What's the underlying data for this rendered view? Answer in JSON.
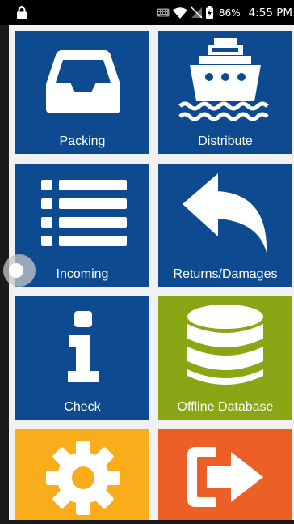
{
  "status_bar": {
    "battery_percent": "86%",
    "time": "4:55 PM",
    "icons": [
      "lock-icon",
      "keyboard-icon",
      "wifi-icon",
      "no-sim-icon",
      "battery-charging-icon"
    ]
  },
  "tiles": [
    {
      "label": "Packing",
      "icon": "inbox-tray-icon",
      "color": "#0d4a90"
    },
    {
      "label": "Distribute",
      "icon": "ship-icon",
      "color": "#0d4a90"
    },
    {
      "label": "Incoming",
      "icon": "list-icon",
      "color": "#0d4a90"
    },
    {
      "label": "Returns/Damages",
      "icon": "reply-arrow-icon",
      "color": "#0d4a90"
    },
    {
      "label": "Check",
      "icon": "info-icon",
      "color": "#0d4a90"
    },
    {
      "label": "Offline Database",
      "icon": "database-icon",
      "color": "#89a615"
    },
    {
      "label": "",
      "icon": "gear-icon",
      "color": "#f9ad1a"
    },
    {
      "label": "",
      "icon": "sign-out-icon",
      "color": "#ec5f26"
    }
  ]
}
